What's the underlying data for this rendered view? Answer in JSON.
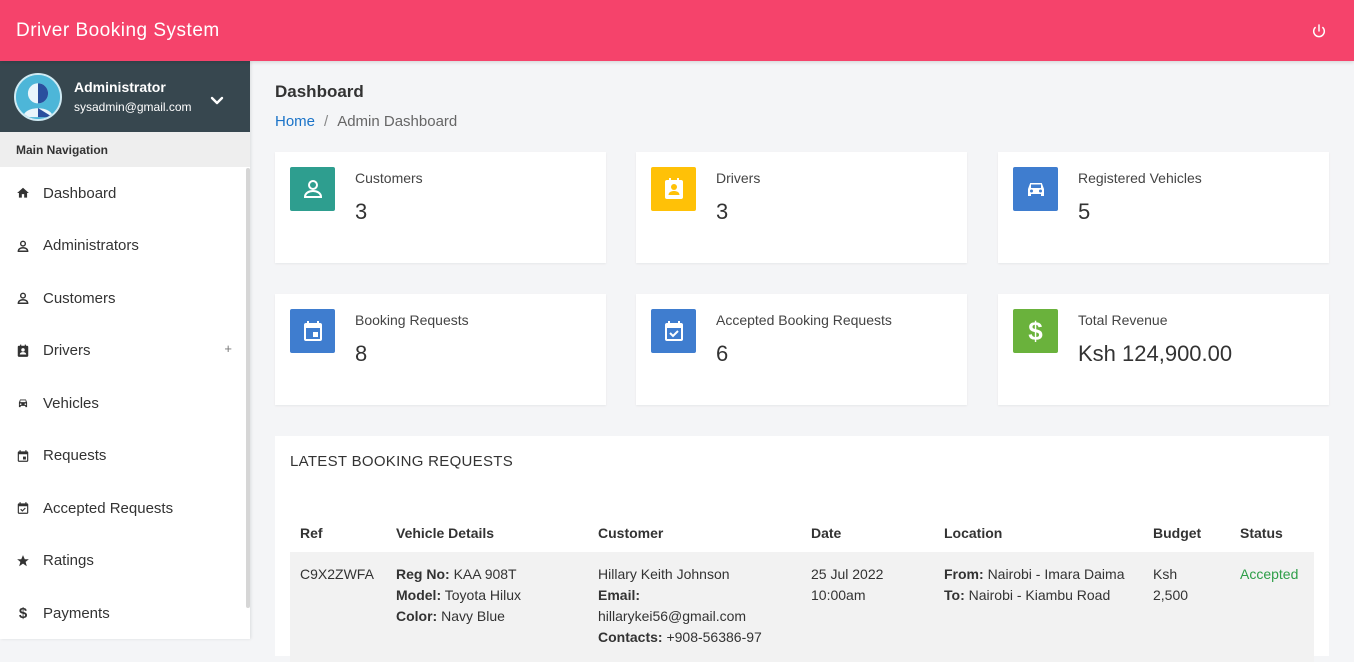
{
  "app": {
    "title": "Driver Booking System"
  },
  "user": {
    "name": "Administrator",
    "email": "sysadmin@gmail.com"
  },
  "sidebar": {
    "header": "Main Navigation",
    "items": [
      {
        "label": "Dashboard",
        "icon": "home-icon"
      },
      {
        "label": "Administrators",
        "icon": "person-icon"
      },
      {
        "label": "Customers",
        "icon": "person-icon"
      },
      {
        "label": "Drivers",
        "icon": "badge-icon",
        "expand": "+"
      },
      {
        "label": "Vehicles",
        "icon": "car-icon"
      },
      {
        "label": "Requests",
        "icon": "calendar-icon"
      },
      {
        "label": "Accepted Requests",
        "icon": "calendar-check-icon"
      },
      {
        "label": "Ratings",
        "icon": "star-icon"
      },
      {
        "label": "Payments",
        "icon": "dollar-icon"
      }
    ]
  },
  "page": {
    "title": "Dashboard",
    "breadcrumb": {
      "home": "Home",
      "sep": "/",
      "current": "Admin Dashboard"
    }
  },
  "stats": [
    {
      "label": "Customers",
      "value": "3",
      "color": "#26a69a",
      "icon": "person-icon"
    },
    {
      "label": "Drivers",
      "value": "3",
      "color": "#ffc107",
      "icon": "badge-icon"
    },
    {
      "label": "Registered Vehicles",
      "value": "5",
      "color": "#3f7dcf",
      "icon": "car-icon"
    },
    {
      "label": "Booking Requests",
      "value": "8",
      "color": "#3f7dcf",
      "icon": "calendar-icon"
    },
    {
      "label": "Accepted Booking Requests",
      "value": "6",
      "color": "#3f7dcf",
      "icon": "calendar-check-icon"
    },
    {
      "label": "Total Revenue",
      "value": "Ksh 124,900.00",
      "color": "#6ab23c",
      "icon": "dollar-icon"
    }
  ],
  "latest": {
    "title": "LATEST BOOKING REQUESTS",
    "columns": [
      "Ref",
      "Vehicle Details",
      "Customer",
      "Date",
      "Location",
      "Budget",
      "Status"
    ],
    "rows": [
      {
        "ref": "C9X2ZWFA",
        "reg_label": "Reg No:",
        "reg": "KAA 908T",
        "model_label": "Model:",
        "model": "Toyota Hilux",
        "color_label": "Color:",
        "color": "Navy Blue",
        "customer": "Hillary Keith Johnson",
        "email_label": "Email:",
        "email": "hillarykei56@gmail.com",
        "contacts_label": "Contacts:",
        "contacts": "+908-56386-97",
        "date": "25 Jul 2022",
        "time": "10:00am",
        "from_label": "From:",
        "from": "Nairobi - Imara Daima",
        "to_label": "To:",
        "to": "Nairobi - Kiambu Road",
        "budget_currency": "Ksh",
        "budget": "2,500",
        "status": "Accepted"
      }
    ]
  }
}
